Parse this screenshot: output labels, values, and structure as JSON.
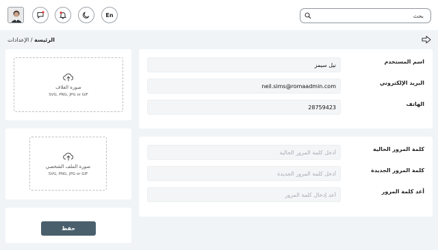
{
  "header": {
    "search_placeholder": "بحث",
    "language_label": "En",
    "icons": [
      "search-icon",
      "moon-icon",
      "bell-icon",
      "chat-icon",
      "avatar"
    ],
    "notification_dot_color": "#e53935"
  },
  "breadcrumb": {
    "home": "الرئيسة",
    "separator": " / ",
    "current": "الإعدادات"
  },
  "uploads": {
    "cover": {
      "title": "صورة الغلاف",
      "formats": "SVG, PNG, JPG or GIF"
    },
    "profile": {
      "title": "صورة الملف الشخصي",
      "formats": "SVG, PNG, JPG or GIF"
    }
  },
  "actions": {
    "save_label": "حفظ"
  },
  "account": {
    "username": {
      "label": "اسم المستخدم",
      "value": "نيل سيمز"
    },
    "email": {
      "label": "البريد الإلكتروني",
      "value": "neil.sims@romaadmin.com"
    },
    "phone": {
      "label": "الهاتف",
      "value": "28759423"
    }
  },
  "password": {
    "current": {
      "label": "كلمة المرور الحالية",
      "placeholder": "أدخل كلمة المرور الحالية"
    },
    "new": {
      "label": "كلمة المرور الجديدة",
      "placeholder": "أدخل كلمة المرور الجديدة"
    },
    "confirm": {
      "label": "أعد كلمة المرور",
      "placeholder": "أعد إدخال كلمة المرور"
    }
  },
  "colors": {
    "background": "#f1f4f7",
    "card": "#ffffff",
    "save_button": "#495f6c",
    "input_background": "#f3f5f7"
  }
}
